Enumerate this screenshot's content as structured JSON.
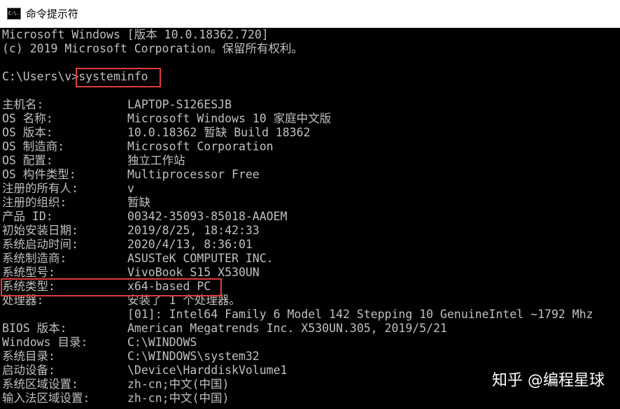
{
  "window": {
    "title": "命令提示符",
    "icon_name": "cmd-icon",
    "icon_text": "C:\\."
  },
  "console": {
    "header_lines": [
      "Microsoft Windows [版本 10.0.18362.720]",
      "(c) 2019 Microsoft Corporation。保留所有权利。"
    ],
    "prompt": "C:\\Users\\v>",
    "command": "systeminfo",
    "info_rows": [
      {
        "label": "主机名:",
        "value": "LAPTOP-S126ESJB"
      },
      {
        "label": "OS 名称:",
        "value": "Microsoft Windows 10 家庭中文版"
      },
      {
        "label": "OS 版本:",
        "value": "10.0.18362 暂缺 Build 18362"
      },
      {
        "label": "OS 制造商:",
        "value": "Microsoft Corporation"
      },
      {
        "label": "OS 配置:",
        "value": "独立工作站"
      },
      {
        "label": "OS 构件类型:",
        "value": "Multiprocessor Free"
      },
      {
        "label": "注册的所有人:",
        "value": "v"
      },
      {
        "label": "注册的组织:",
        "value": "暂缺"
      },
      {
        "label": "产品 ID:",
        "value": "00342-35093-85018-AAOEM"
      },
      {
        "label": "初始安装日期:",
        "value": "2019/8/25, 18:42:33"
      },
      {
        "label": "系统启动时间:",
        "value": "2020/4/13, 8:36:01"
      },
      {
        "label": "系统制造商:",
        "value": "ASUSTeK COMPUTER INC."
      },
      {
        "label": "系统型号:",
        "value": "VivoBook S15 X530UN"
      },
      {
        "label": "系统类型:",
        "value": "x64-based PC"
      },
      {
        "label": "处理器:",
        "value": "安装了 1 个处理器。"
      },
      {
        "label": "",
        "value": "[01]: Intel64 Family 6 Model 142 Stepping 10 GenuineIntel ~1792 Mhz"
      },
      {
        "label": "BIOS 版本:",
        "value": "American Megatrends Inc. X530UN.305, 2019/5/21"
      },
      {
        "label": "Windows 目录:",
        "value": "C:\\WINDOWS"
      },
      {
        "label": "系统目录:",
        "value": "C:\\WINDOWS\\system32"
      },
      {
        "label": "启动设备:",
        "value": "\\Device\\HarddiskVolume1"
      },
      {
        "label": "系统区域设置:",
        "value": "zh-cn;中文(中国)"
      },
      {
        "label": "输入法区域设置:",
        "value": "zh-cn;中文(中国)"
      }
    ]
  },
  "watermark": "知乎 @编程星球",
  "colors": {
    "console_bg": "#000000",
    "console_text": "#c0c0c0",
    "titlebar_bg": "#ffffff",
    "highlight": "#e03c3c"
  }
}
